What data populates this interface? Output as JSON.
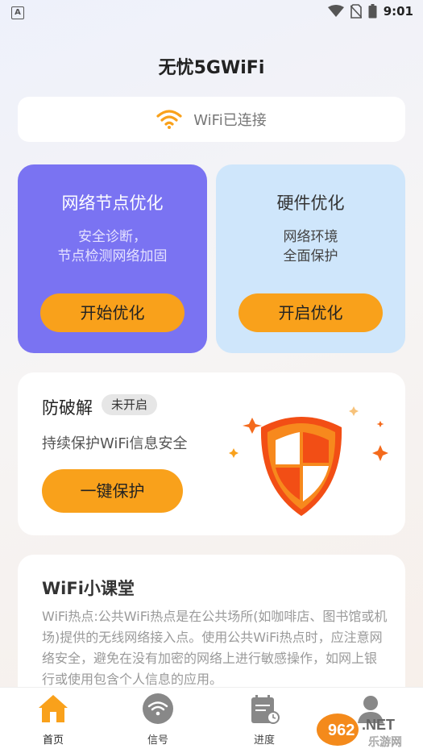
{
  "status_bar": {
    "time": "9:01",
    "left_icon": "A"
  },
  "header": {
    "title": "无忧5GWiFi"
  },
  "wifi_status": {
    "text": "WiFi已连接",
    "icon": "wifi-icon"
  },
  "cards": [
    {
      "title": "网络节点优化",
      "desc_lines": [
        "安全诊断，",
        "节点检测网络加固"
      ],
      "button": "开始优化"
    },
    {
      "title": "硬件优化",
      "desc_lines": [
        "网络环境",
        "全面保护"
      ],
      "button": "开启优化"
    }
  ],
  "protect": {
    "title": "防破解",
    "badge": "未开启",
    "desc": "持续保护WiFi信息安全",
    "button": "一键保护"
  },
  "classroom": {
    "title": "WiFi小课堂",
    "body": "WiFi热点:公共WiFi热点是在公共场所(如咖啡店、图书馆或机场)提供的无线网络接入点。使用公共WiFi热点时，应注意网络安全，避免在没有加密的网络上进行敏感操作，如网上银行或使用包含个人信息的应用。"
  },
  "nav": [
    {
      "label": "首页",
      "icon": "home-icon",
      "active": true
    },
    {
      "label": "信号",
      "icon": "signal-icon"
    },
    {
      "label": "进度",
      "icon": "progress-icon"
    }
  ],
  "watermark": {
    "brand": "962.NET",
    "sub": "乐游网"
  },
  "colors": {
    "primary_orange": "#f9a11b",
    "purple": "#7a73f2",
    "light_blue": "#cfe6fb"
  }
}
